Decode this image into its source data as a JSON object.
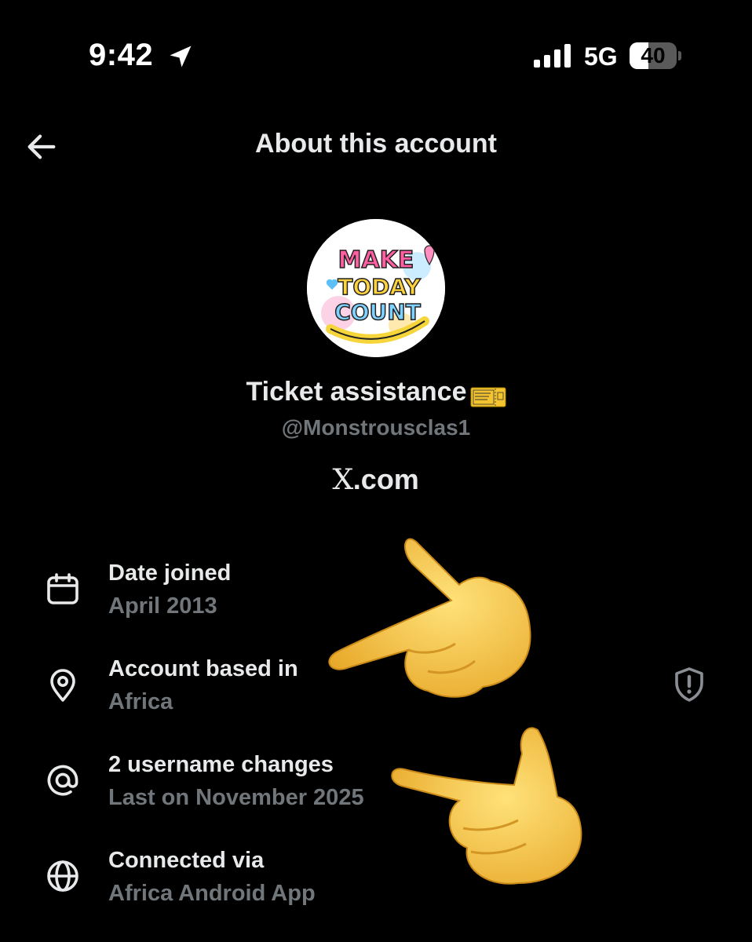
{
  "status_bar": {
    "time": "9:42",
    "network": "5G",
    "battery": "40",
    "battery_level": 0.4
  },
  "header": {
    "title": "About this account"
  },
  "profile": {
    "avatar_text": [
      "MAKE",
      "TODAY",
      "COUNT"
    ],
    "display_name": "Ticket assistance",
    "handle": "@Monstrousclas1",
    "domain": ".com",
    "domain_logo": "X"
  },
  "info": [
    {
      "icon": "calendar-icon",
      "label": "Date joined",
      "value": "April 2013"
    },
    {
      "icon": "location-pin-icon",
      "label": "Account based in",
      "value": "Africa"
    },
    {
      "icon": "at-sign-icon",
      "label": "2 username changes",
      "value": "Last on November 2025"
    },
    {
      "icon": "globe-icon",
      "label": "Connected via",
      "value": "Africa Android App"
    }
  ],
  "colors": {
    "background": "#000000",
    "primary_text": "#e7e9ea",
    "secondary_text": "#71767b",
    "emoji_yellow": "#f6c63e"
  }
}
